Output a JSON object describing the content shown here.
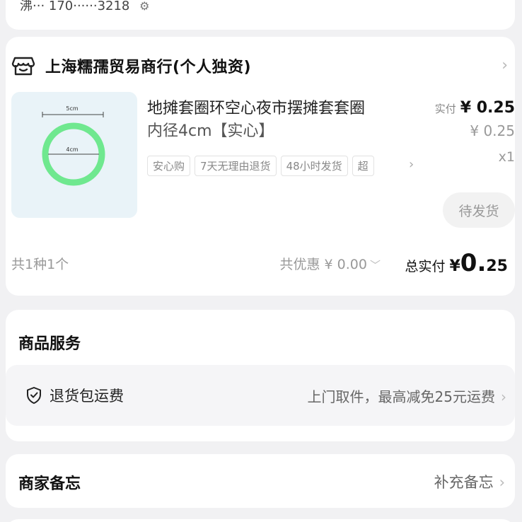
{
  "address": {
    "masked_line": "沸··· 170······3218"
  },
  "shop": {
    "name": "上海糯孺贸易商行(个人独资)"
  },
  "product": {
    "title": "地摊套圈环空心夜市摆摊套套圈",
    "spec": "内径4cm【实心】",
    "image_labels": {
      "outer": "5cm",
      "inner": "4cm"
    },
    "price_label": "实付",
    "price_actual": "¥ 0.25",
    "price_original": "¥ 0.25",
    "quantity": "x1",
    "tags": [
      "安心购",
      "7天无理由退货",
      "48小时发货",
      "超"
    ],
    "status": "待发货"
  },
  "summary": {
    "count": "共1种1个",
    "discount": "共优惠 ¥ 0.00",
    "total_label": "总实付",
    "total_yen": "¥",
    "total_int": "0.",
    "total_dec": "25"
  },
  "service": {
    "title": "商品服务",
    "item_label": "退货包运费",
    "item_desc": "上门取件，最高减免25元运费"
  },
  "memo": {
    "title": "商家备忘",
    "action": "补充备忘"
  }
}
